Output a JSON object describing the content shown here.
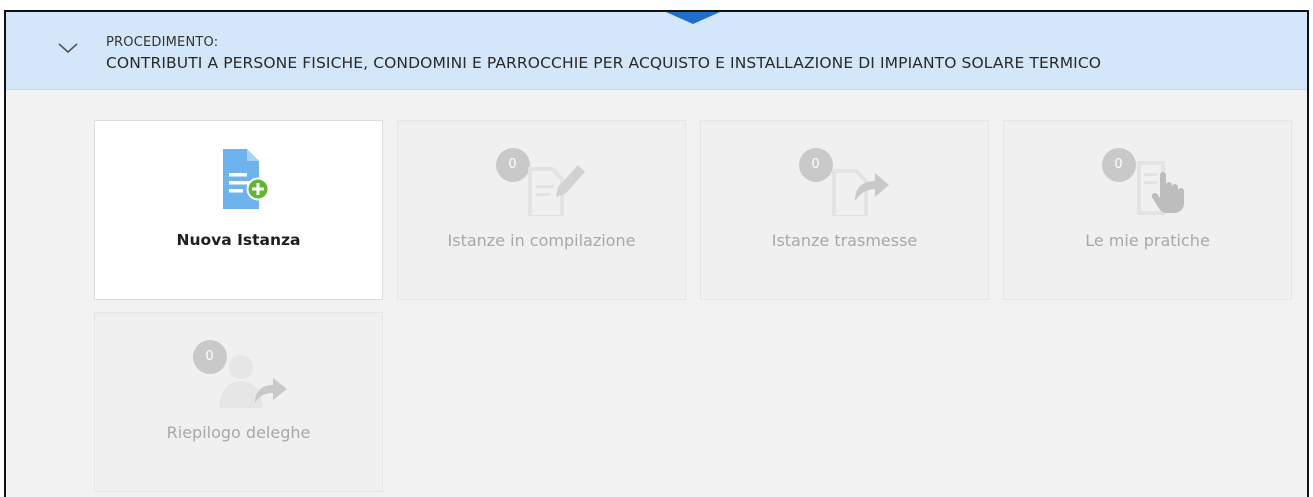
{
  "procedure": {
    "label": "PROCEDIMENTO:",
    "title": "CONTRIBUTI A PERSONE FISICHE, CONDOMINI E PARROCCHIE PER ACQUISTO E INSTALLAZIONE DI IMPIANTO SOLARE TERMICO"
  },
  "tiles": [
    {
      "label": "Nuova Istanza",
      "icon": "new-document-plus-icon"
    },
    {
      "label": "Istanze in compilazione",
      "count": "0",
      "icon": "document-edit-icon"
    },
    {
      "label": "Istanze trasmesse",
      "count": "0",
      "icon": "document-send-icon"
    },
    {
      "label": "Le mie pratiche",
      "count": "0",
      "icon": "document-hand-icon"
    },
    {
      "label": "Riepilogo deleghe",
      "count": "0",
      "icon": "user-forward-icon"
    }
  ],
  "colors": {
    "header_bg": "#d4e6fa",
    "accent_blue": "#1f6fc9",
    "plus_green": "#5fb82e",
    "doc_blue": "#6fb3ec",
    "muted": "#c9c9c9"
  }
}
